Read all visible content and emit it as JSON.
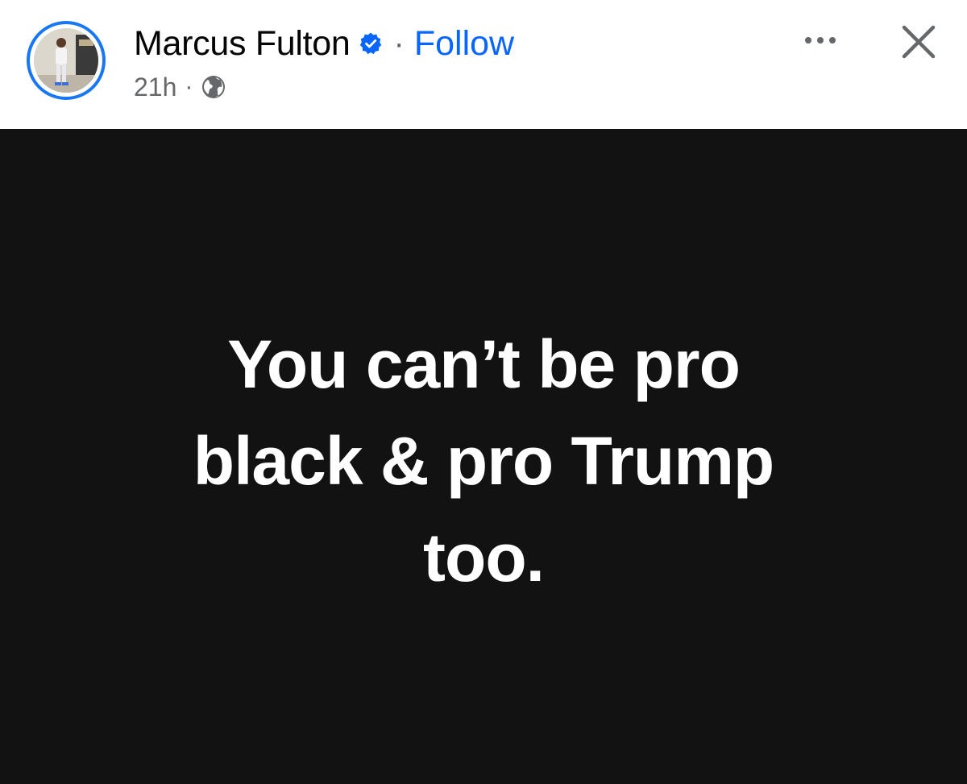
{
  "author": {
    "name": "Marcus Fulton",
    "follow_label": "Follow",
    "separator": "·",
    "verified_icon": "verified-badge-icon",
    "avatar_ring_color": "#1877f2"
  },
  "meta": {
    "time": "21h",
    "separator": "·",
    "audience_icon": "globe-icon"
  },
  "actions": {
    "more_icon": "more-options-icon",
    "close_icon": "close-icon"
  },
  "post": {
    "background_color": "#121212",
    "text_color": "#ffffff",
    "lines": [
      "You can’t be pro",
      "black & pro Trump",
      "too."
    ]
  },
  "colors": {
    "link": "#0866ff",
    "secondary_text": "#65676b",
    "primary_text": "#050505"
  }
}
